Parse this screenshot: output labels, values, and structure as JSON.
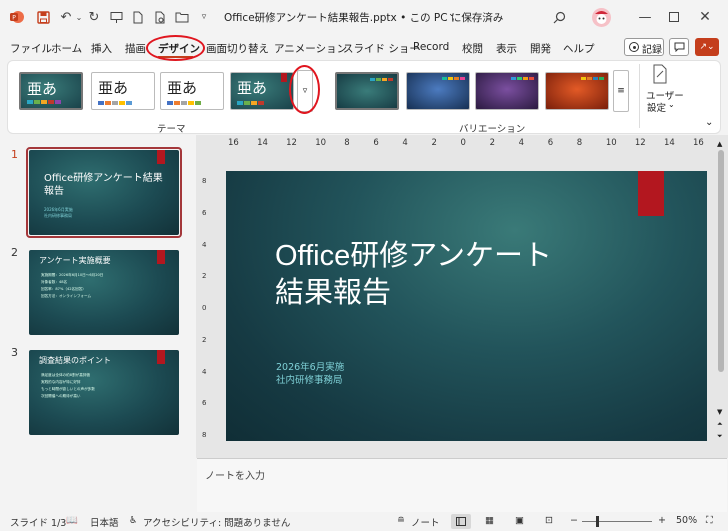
{
  "titlebar": {
    "doc_title": "Office研修アンケート結果報告.pptx • この PC に保存済み",
    "icons": [
      "powerpoint-logo",
      "save-icon",
      "undo-icon",
      "redo-icon",
      "present-icon",
      "new-icon",
      "print-preview-icon",
      "open-icon",
      "customize-icon",
      "search-icon",
      "avatar",
      "minimize-icon",
      "maximize-icon",
      "close-icon"
    ]
  },
  "tabs": [
    "ファイル",
    "ホーム",
    "挿入",
    "描画",
    "デザイン",
    "画面切り替え",
    "アニメーション",
    "スライド ショー",
    "Record",
    "校閲",
    "表示",
    "開発",
    "ヘルプ"
  ],
  "tab_actions": {
    "record": "記録"
  },
  "ribbon": {
    "theme_glyphs": [
      "亜あ",
      "亜あ",
      "亜あ",
      "亜あ"
    ],
    "theme_group_label": "テーマ",
    "variation_group_label": "バリエーション",
    "user_settings_line1": "ユーザー",
    "user_settings_line2": "設定"
  },
  "thumbnails": [
    {
      "num": "1",
      "title": "Office研修アンケート結果報告",
      "sub1": "2026年6月実施",
      "sub2": "社内研修事務局"
    },
    {
      "num": "2",
      "title": "アンケート実施概要",
      "bullets": [
        "実施期間：2026年6月10日〜6月20日",
        "対象者数：48名",
        "回答率：87%（42名回答）",
        "回答方法：オンラインフォーム"
      ]
    },
    {
      "num": "3",
      "title": "調査結果のポイント",
      "bullets": [
        "満足度は全体の約8割が高評価",
        "実践的な内容が特に好評",
        "もっと時間が欲しいとの声が多数",
        "次回開催への期待が高い"
      ]
    }
  ],
  "slide": {
    "title_line1": "Office研修アンケート",
    "title_line2": "結果報告",
    "sub_line1": "2026年6月実施",
    "sub_line2": "社内研修事務局"
  },
  "ruler_h": [
    "16",
    "14",
    "12",
    "10",
    "8",
    "6",
    "4",
    "2",
    "0",
    "2",
    "4",
    "6",
    "8",
    "10",
    "12",
    "14",
    "16"
  ],
  "ruler_v": [
    "8",
    "6",
    "4",
    "2",
    "0",
    "2",
    "4",
    "6",
    "8"
  ],
  "notes_placeholder": "ノートを入力",
  "status": {
    "slide_count": "スライド 1/3",
    "language": "日本語",
    "accessibility": "アクセシビリティ: 問題ありません",
    "notes_btn": "ノート",
    "zoom_minus": "−",
    "zoom_plus": "+",
    "zoom": "50%"
  },
  "colors": {
    "accent": "#c43e1c",
    "highlight": "#e0161f",
    "slide_bg": "#1c4a52"
  }
}
